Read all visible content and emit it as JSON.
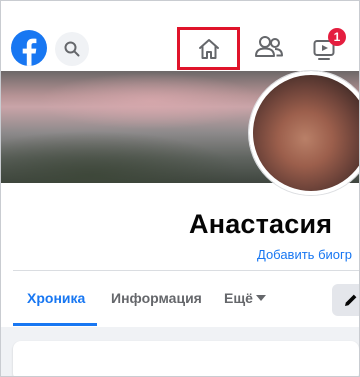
{
  "topbar": {
    "logo_icon": "facebook-logo-icon",
    "search_icon": "search-icon",
    "nav": [
      {
        "name": "home",
        "icon": "home-icon",
        "highlighted": true
      },
      {
        "name": "friends",
        "icon": "friends-icon"
      },
      {
        "name": "watch",
        "icon": "video-icon",
        "badge": "1"
      }
    ],
    "highlight_color": "#e0142a"
  },
  "profile": {
    "name": "Анастасия",
    "name_trailing": "",
    "bio_link": "Добавить биогр"
  },
  "tabs": [
    {
      "label": "Хроника",
      "active": true
    },
    {
      "label": "Информация",
      "active": false
    },
    {
      "label": "Ещё",
      "active": false
    }
  ],
  "edit_icon": "pencil-icon",
  "colors": {
    "brand": "#1877f2",
    "badge": "#e41e3f"
  }
}
